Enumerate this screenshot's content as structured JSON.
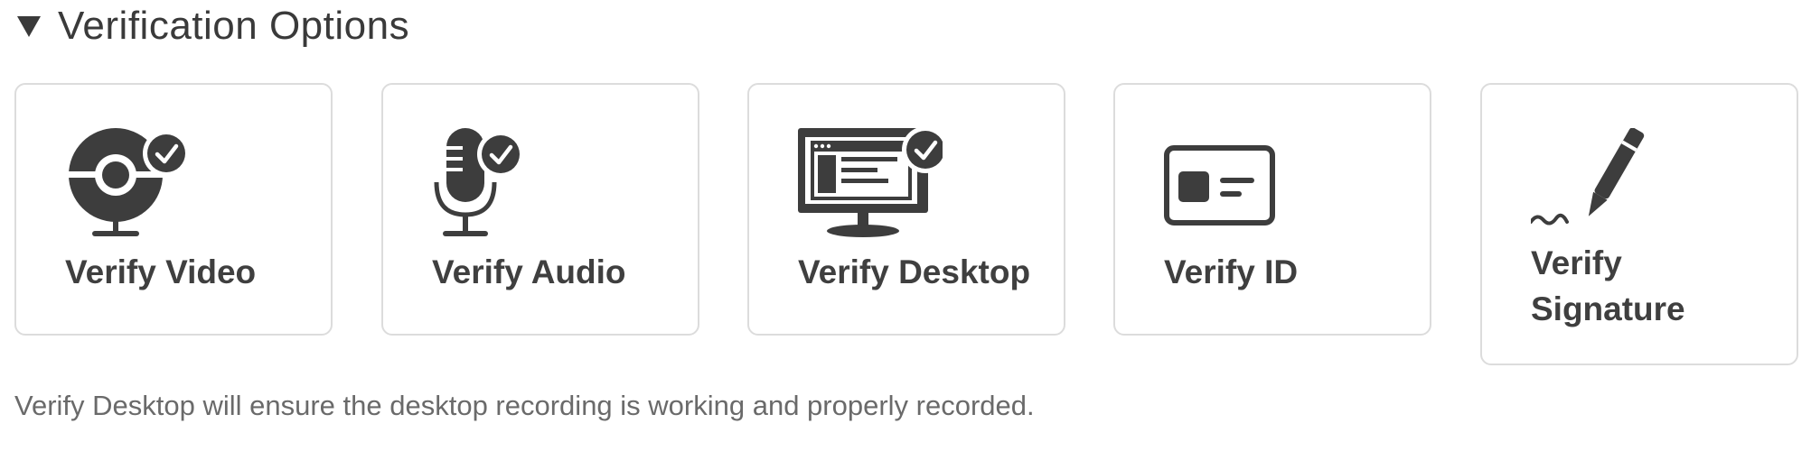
{
  "section": {
    "title": "Verification Options",
    "expanded": true
  },
  "options": [
    {
      "label": "Verify Video",
      "icon": "webcam-icon",
      "status": "verified"
    },
    {
      "label": "Verify Audio",
      "icon": "microphone-icon",
      "status": "verified"
    },
    {
      "label": "Verify Desktop",
      "icon": "monitor-icon",
      "status": "verified",
      "selected": true
    },
    {
      "label": "Verify ID",
      "icon": "id-card-icon"
    },
    {
      "label": "Verify Signature",
      "icon": "signature-pen-icon"
    }
  ],
  "description": "Verify Desktop will ensure the desktop recording is working and properly recorded.",
  "colors": {
    "icon": "#3d3d3d",
    "card_border": "#dcdcdc",
    "title_text": "#3a3a3a",
    "description_text": "#6a6a6a"
  }
}
